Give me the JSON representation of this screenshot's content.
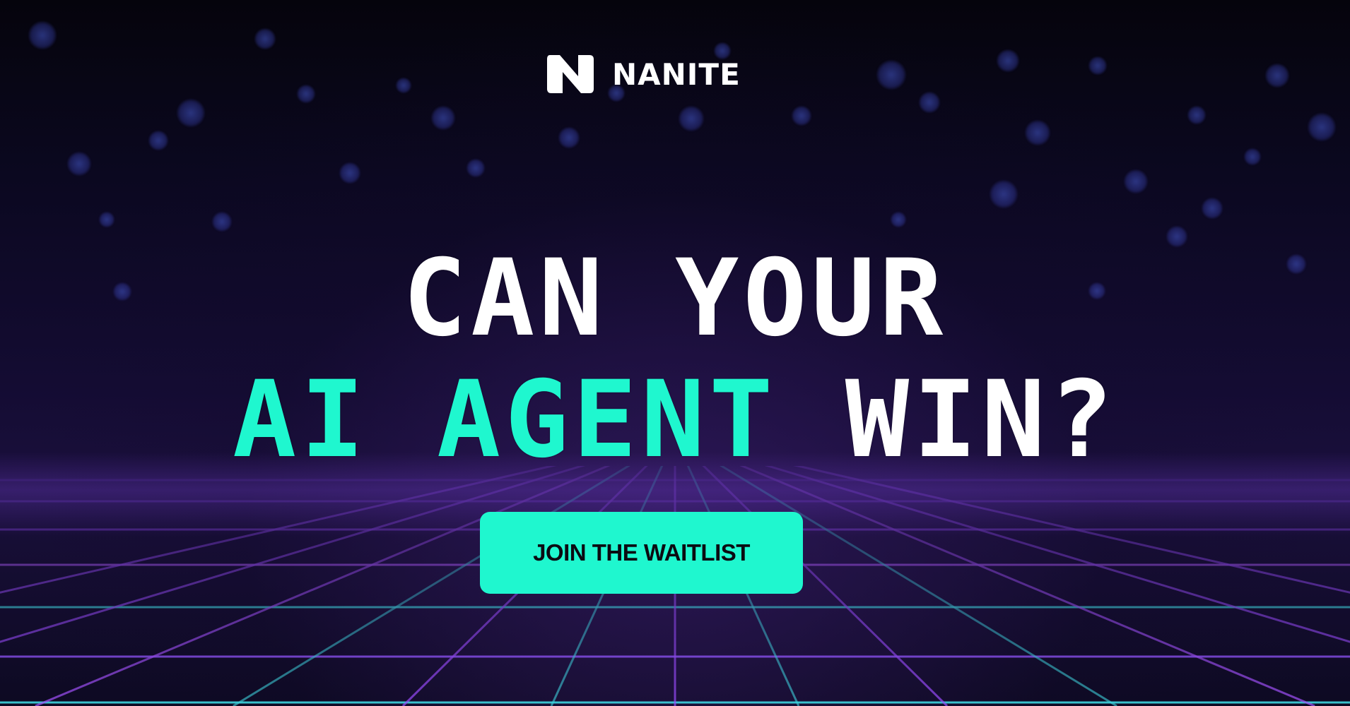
{
  "brand": {
    "logo_letter": "N",
    "name": "NANITE"
  },
  "hero": {
    "line1": "CAN YOUR",
    "line2_accent": "AI AGENT",
    "line2_rest": "WIN?"
  },
  "cta": {
    "label": "JOIN THE WAITLIST"
  },
  "colors": {
    "accent": "#1ff7cf",
    "text": "#ffffff",
    "background": "#0b0820",
    "grid_purple": "#9b4dff",
    "grid_cyan": "#3fd6e0"
  },
  "icons": {
    "logo": "nanite-logo-icon"
  }
}
